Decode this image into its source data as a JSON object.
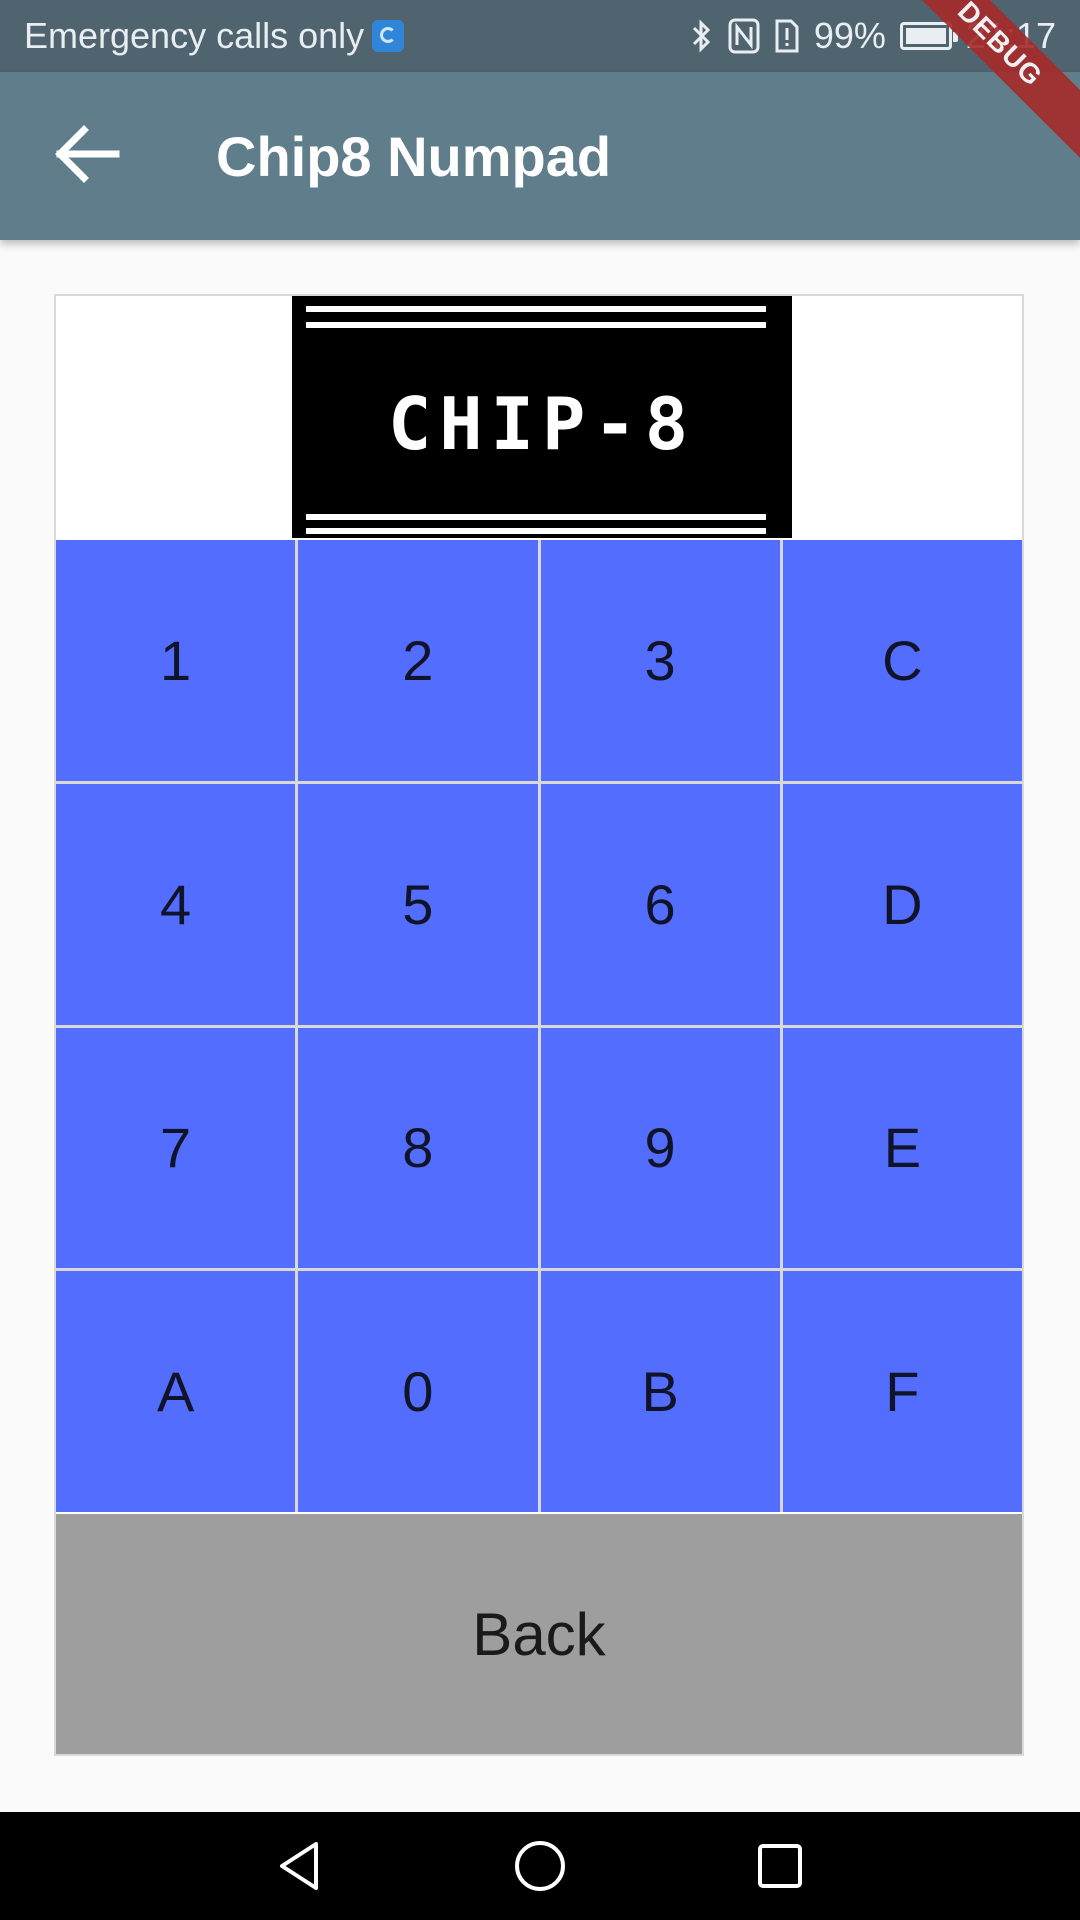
{
  "status_bar": {
    "carrier_text": "Emergency calls only",
    "battery_text": "99%",
    "time": "21:17",
    "icons": [
      "carrier-app-icon",
      "bluetooth-icon",
      "nfc-icon",
      "alert-icon",
      "battery-icon"
    ]
  },
  "app_bar": {
    "title": "Chip8 Numpad",
    "back_icon": "arrow-left-icon",
    "color": "#607d8b"
  },
  "debug_banner": "DEBUG",
  "logo": {
    "text": "CHIP-8"
  },
  "keypad": {
    "color": "#536dfe",
    "keys": [
      "1",
      "2",
      "3",
      "C",
      "4",
      "5",
      "6",
      "D",
      "7",
      "8",
      "9",
      "E",
      "A",
      "0",
      "B",
      "F"
    ]
  },
  "back_button": {
    "label": "Back",
    "color": "#9e9e9e"
  },
  "nav_bar": {
    "icons": [
      "nav-back-icon",
      "nav-home-icon",
      "nav-recents-icon"
    ]
  }
}
